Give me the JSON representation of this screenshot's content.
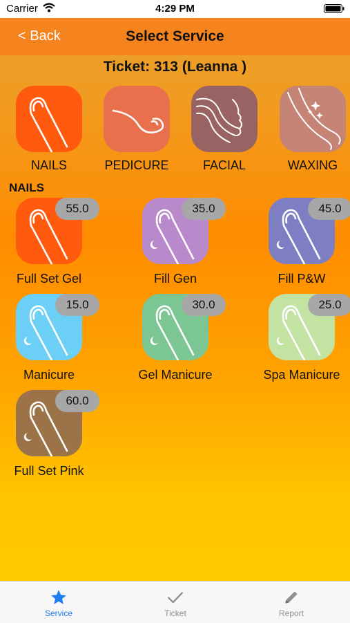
{
  "status": {
    "carrier": "Carrier",
    "time": "4:29 PM"
  },
  "nav": {
    "back": "< Back",
    "title": "Select Service"
  },
  "ticket": "Ticket: 313 (Leanna )",
  "categories": [
    {
      "label": "NAILS",
      "color": "#FF5A0E"
    },
    {
      "label": "PEDICURE",
      "color": "#E8704C"
    },
    {
      "label": "FACIAL",
      "color": "#9A6363"
    },
    {
      "label": "WAXING",
      "color": "#C58476"
    }
  ],
  "section": "NAILS",
  "services": [
    {
      "label": "Full Set Gel",
      "price": "55.0",
      "color": "#FF5A0E"
    },
    {
      "label": "Fill Gen",
      "price": "35.0",
      "color": "#B98ACB"
    },
    {
      "label": "Fill P&W",
      "price": "45.0",
      "color": "#7E7FC3"
    },
    {
      "label": "Manicure",
      "price": "15.0",
      "color": "#6CCFF6"
    },
    {
      "label": "Gel Manicure",
      "price": "30.0",
      "color": "#7CC693"
    },
    {
      "label": "Spa Manicure",
      "price": "25.0",
      "color": "#C3E3A2"
    },
    {
      "label": "Full Set Pink",
      "price": "60.0",
      "color": "#9C7248"
    }
  ],
  "tabs": [
    {
      "label": "Service",
      "icon": "star-icon",
      "active": true
    },
    {
      "label": "Ticket",
      "icon": "checkmark-icon",
      "active": false
    },
    {
      "label": "Report",
      "icon": "pencil-icon",
      "active": false
    }
  ],
  "colors": {
    "active_tab": "#1E7CF2",
    "inactive_tab": "#8E8E93",
    "navbar": "#F5841F"
  }
}
